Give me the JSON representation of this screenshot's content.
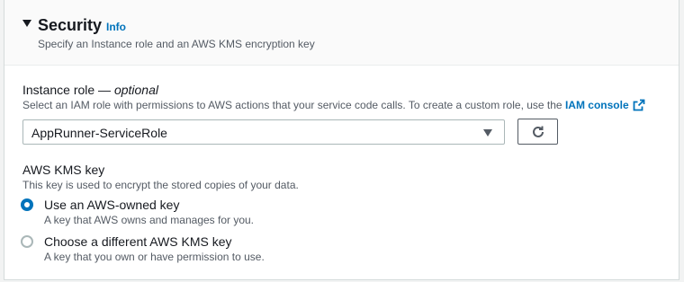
{
  "section": {
    "title": "Security",
    "info_label": "Info",
    "subtitle": "Specify an Instance role and an AWS KMS encryption key"
  },
  "instance_role": {
    "label": "Instance role — ",
    "optional": "optional",
    "description": "Select an IAM role with permissions to AWS actions that your service code calls. To create a custom role, use the ",
    "iam_link": "IAM console",
    "selected_value": "AppRunner-ServiceRole"
  },
  "kms_key": {
    "label": "AWS KMS key",
    "description": "This key is used to encrypt the stored copies of your data.",
    "options": [
      {
        "label": "Use an AWS-owned key",
        "description": "A key that AWS owns and manages for you.",
        "checked": true
      },
      {
        "label": "Choose a different AWS KMS key",
        "description": "A key that you own or have permission to use.",
        "checked": false
      }
    ]
  },
  "colors": {
    "link": "#0073bb",
    "text": "#16191f",
    "secondary_text": "#545b64",
    "border": "#aab7b8"
  },
  "icons": [
    "caret-down-icon",
    "external-link-icon",
    "refresh-icon",
    "dropdown-caret-icon"
  ]
}
